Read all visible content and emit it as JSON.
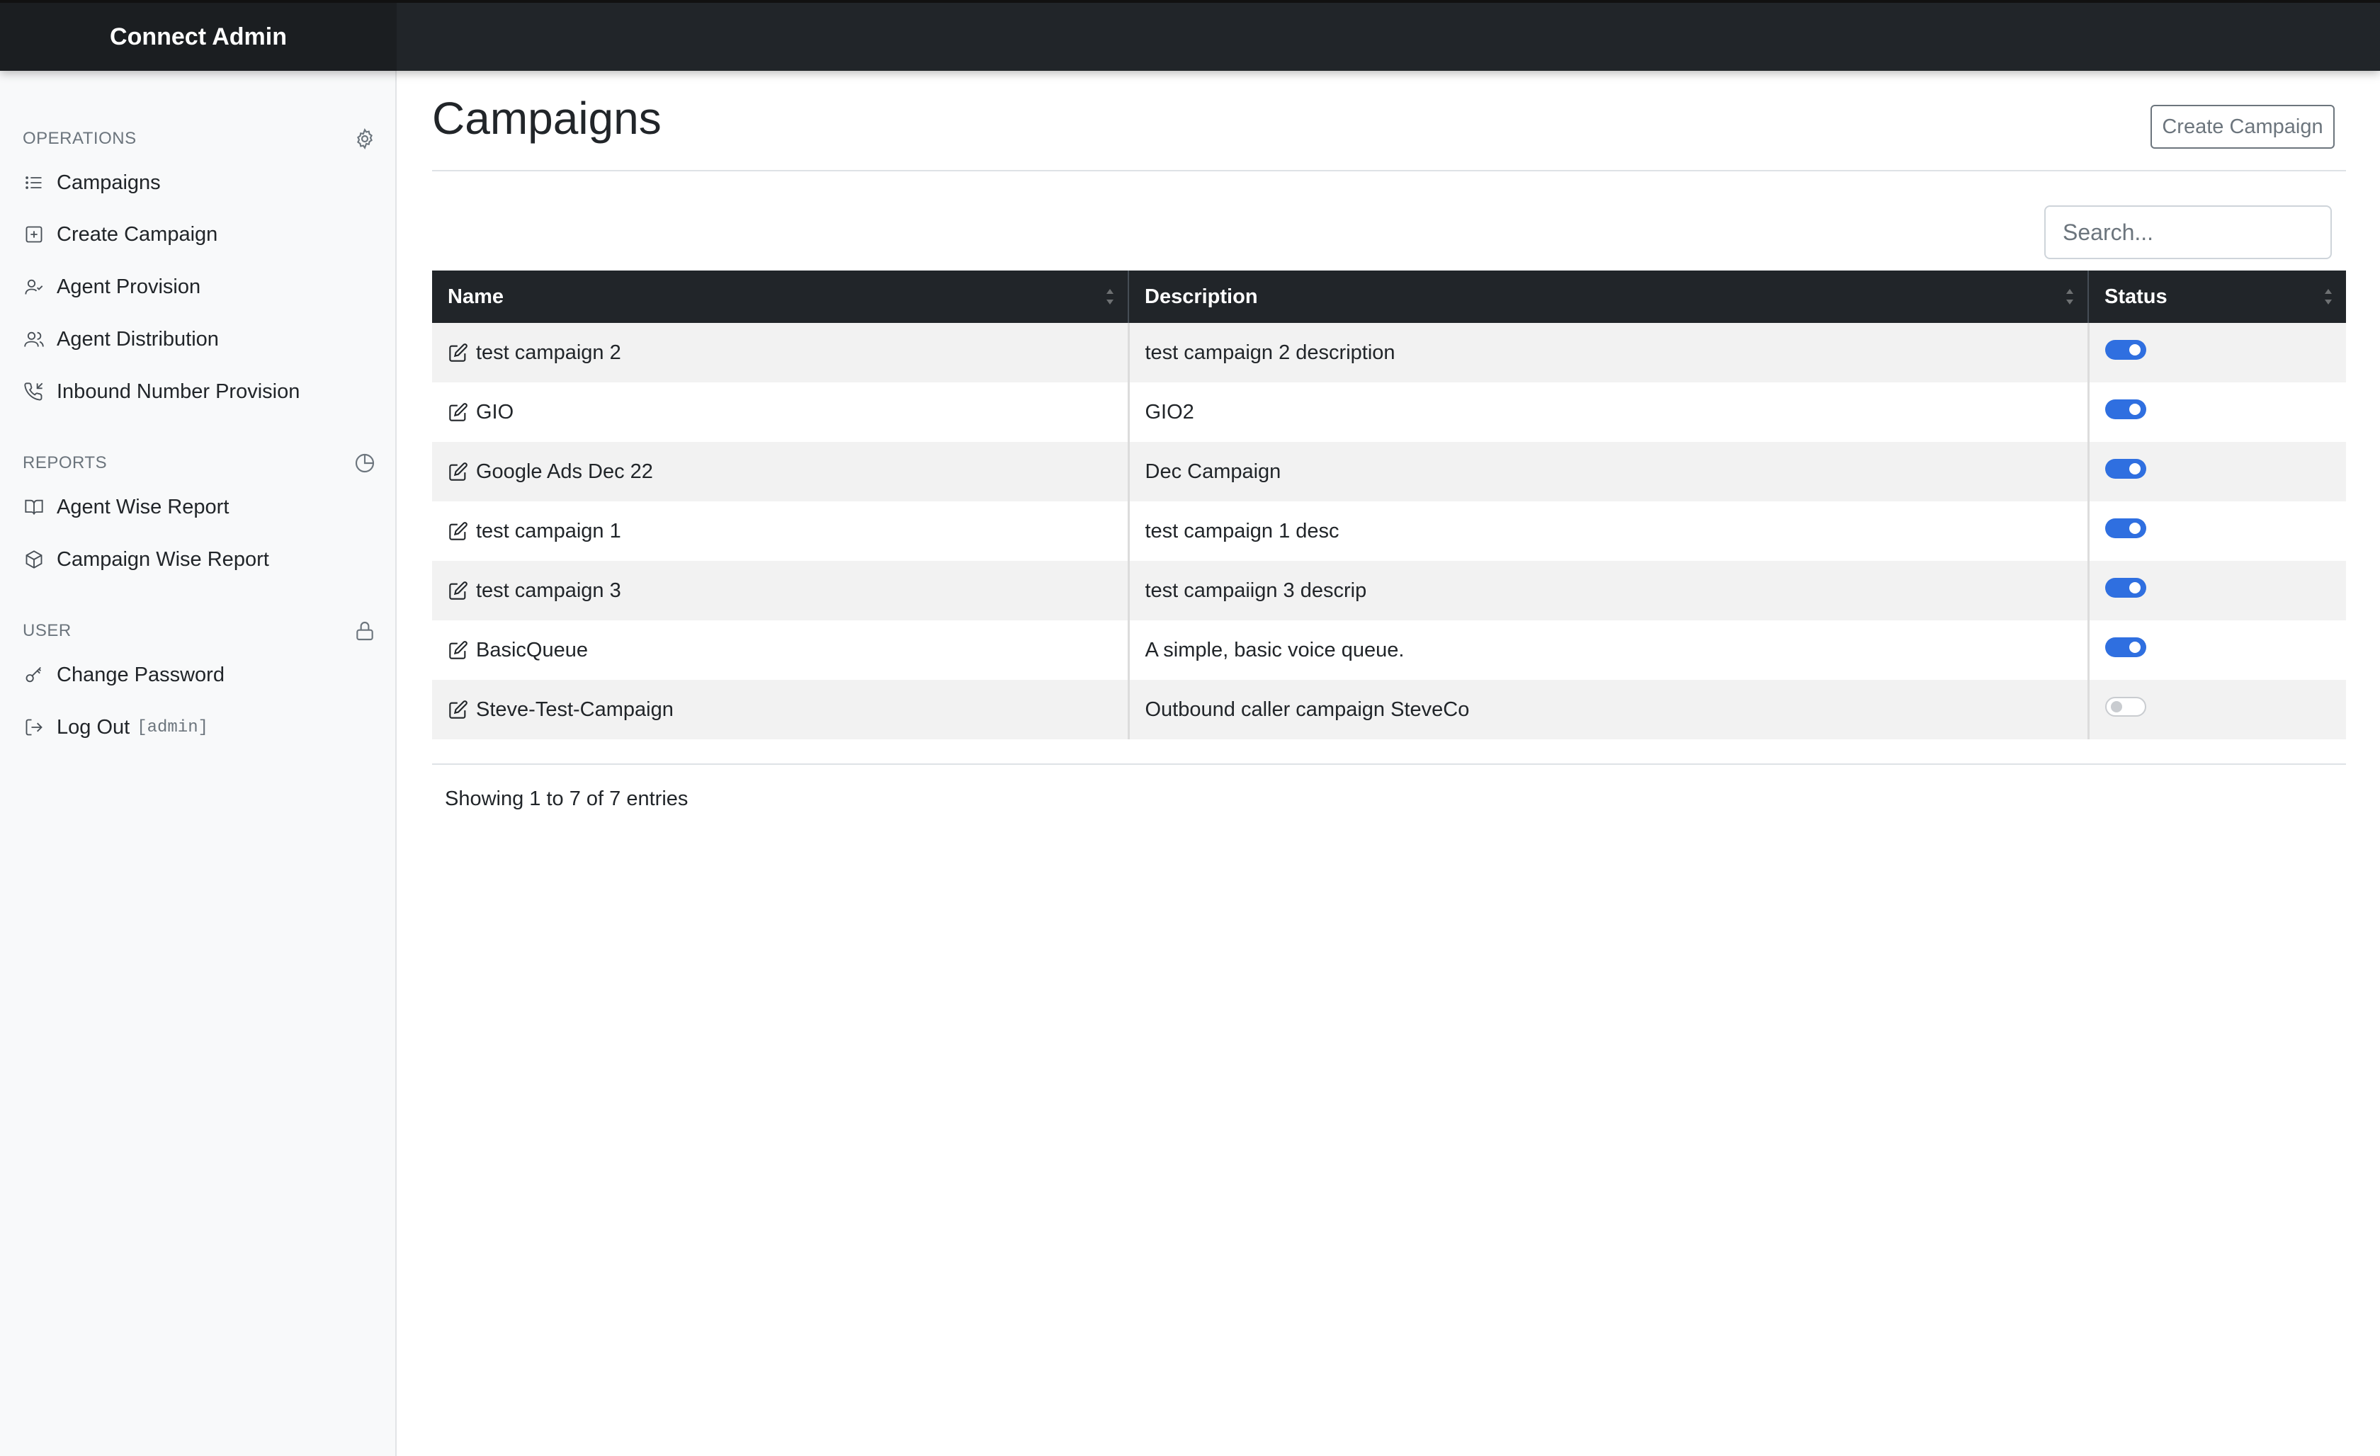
{
  "app": {
    "title": "Connect Admin"
  },
  "sidebar": {
    "operations": {
      "heading": "OPERATIONS",
      "icon": "gear-icon",
      "items": [
        {
          "label": "Campaigns",
          "icon": "list-icon"
        },
        {
          "label": "Create Campaign",
          "icon": "plus-square-icon"
        },
        {
          "label": "Agent Provision",
          "icon": "user-check-icon"
        },
        {
          "label": "Agent Distribution",
          "icon": "users-icon"
        },
        {
          "label": "Inbound Number Provision",
          "icon": "phone-incoming-icon"
        }
      ]
    },
    "reports": {
      "heading": "REPORTS",
      "icon": "pie-chart-icon",
      "items": [
        {
          "label": "Agent Wise Report",
          "icon": "book-open-icon"
        },
        {
          "label": "Campaign Wise Report",
          "icon": "box-icon"
        }
      ]
    },
    "user": {
      "heading": "USER",
      "icon": "lock-icon",
      "items": [
        {
          "label": "Change Password",
          "icon": "key-icon"
        },
        {
          "label": "Log Out",
          "suffix": "[admin]",
          "icon": "log-out-icon"
        }
      ]
    }
  },
  "main": {
    "title": "Campaigns",
    "create_button": "Create Campaign",
    "search_placeholder": "Search...",
    "columns": [
      "Name",
      "Description",
      "Status"
    ],
    "rows": [
      {
        "name": "test campaign 2",
        "description": "test campaign 2 description",
        "enabled": true
      },
      {
        "name": "GIO",
        "description": "GIO2",
        "enabled": true
      },
      {
        "name": "Google Ads Dec 22",
        "description": "Dec Campaign",
        "enabled": true
      },
      {
        "name": "test campaign 1",
        "description": "test campaign 1 desc",
        "enabled": true
      },
      {
        "name": "test campaign 3",
        "description": "test campaiign 3 descrip",
        "enabled": true
      },
      {
        "name": "BasicQueue",
        "description": "A simple, basic voice queue.",
        "enabled": true
      },
      {
        "name": "Steve-Test-Campaign",
        "description": "Outbound caller campaign SteveCo",
        "enabled": false
      }
    ],
    "info": "Showing 1 to 7 of 7 entries"
  },
  "colors": {
    "accent": "#2f6fe0",
    "topbar": "#212529",
    "table_header": "#212529",
    "sidebar_bg": "#f8f9fa"
  }
}
